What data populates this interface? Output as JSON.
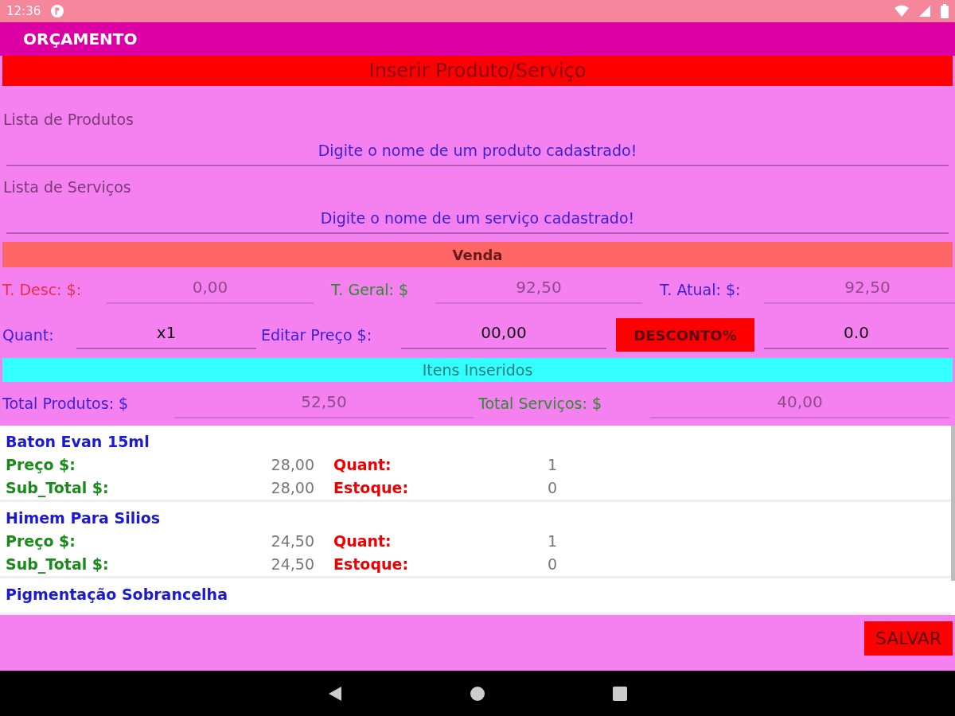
{
  "status_bar": {
    "time": "12:36"
  },
  "app_bar": {
    "title": "ORÇAMENTO"
  },
  "insert_header": {
    "title": "Inserir Produto/Serviço"
  },
  "product_list": {
    "label": "Lista de Produtos",
    "placeholder": "Digite o nome de um produto cadastrado!"
  },
  "service_list": {
    "label": "Lista de Serviços",
    "placeholder": "Digite o nome de um serviço cadastrado!"
  },
  "sale_header": {
    "title": "Venda"
  },
  "totals_row": [
    {
      "label": "T. Desc: $:",
      "color": "#e8304a",
      "value": "0,00",
      "disabled": true
    },
    {
      "label": "T. Geral: $",
      "color": "#2f8a2f",
      "value": "92,50",
      "disabled": true
    },
    {
      "label": "T. Atual: $:",
      "color": "#3a1fd6",
      "value": "92,50",
      "disabled": true
    }
  ],
  "edit_row": {
    "quantity": {
      "label": "Quant:",
      "value": "x1",
      "disabled": false
    },
    "price": {
      "label": "Editar Preço $:",
      "value": "00,00",
      "disabled": false
    },
    "discount_button": "DESCONTO%",
    "discount": {
      "value": "0.0",
      "disabled": false
    }
  },
  "items_header": {
    "title": "Itens Inseridos"
  },
  "sum_row": [
    {
      "label": "Total Produtos: $",
      "color": "#3a1fd6",
      "value": "52,50",
      "disabled": true
    },
    {
      "label": "Total Serviços: $",
      "color": "#2f8a2f",
      "value": "40,00",
      "disabled": true
    }
  ],
  "items": [
    {
      "name": "Baton Evan 15ml",
      "fields": [
        {
          "price_label": "Preço $:",
          "price": "28,00",
          "qty_label": "Quant:",
          "qty": "1"
        },
        {
          "price_label": "Sub_Total $:",
          "price": "28,00",
          "qty_label": "Estoque:",
          "qty": "0"
        }
      ]
    },
    {
      "name": "Himem Para Silios",
      "fields": [
        {
          "price_label": "Preço $:",
          "price": "24,50",
          "qty_label": "Quant:",
          "qty": "1"
        },
        {
          "price_label": "Sub_Total $:",
          "price": "24,50",
          "qty_label": "Estoque:",
          "qty": "0"
        }
      ]
    },
    {
      "name": "Pigmentação Sobrancelha"
    }
  ],
  "save_button": "SALVAR"
}
